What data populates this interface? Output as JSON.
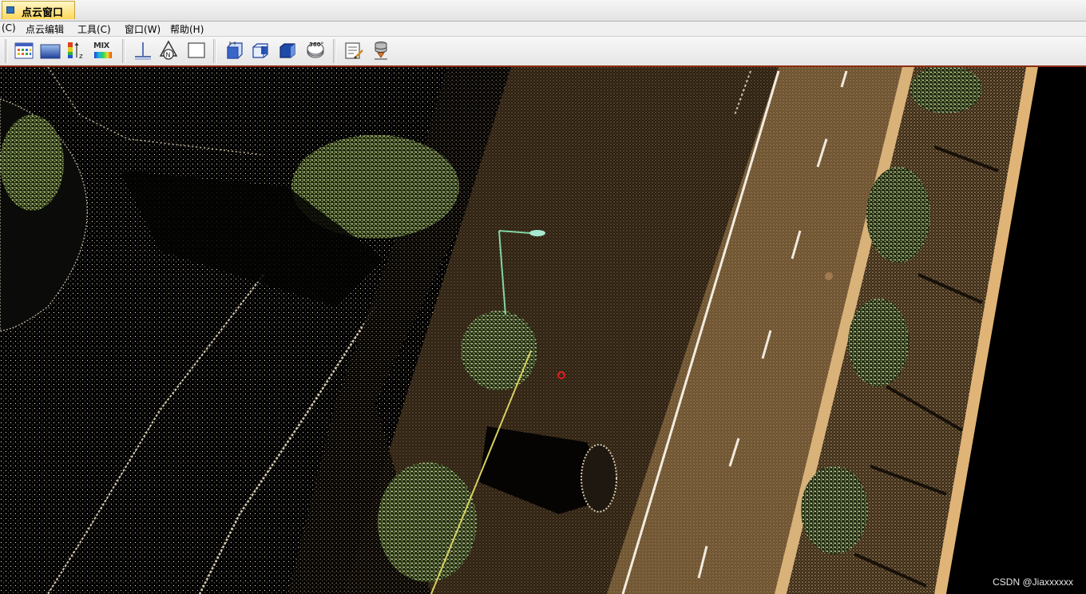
{
  "window": {
    "tab_label": "点云窗口"
  },
  "menu": {
    "items": [
      {
        "label": "(C)"
      },
      {
        "label": "点云编辑"
      },
      {
        "label": "工具(C)"
      },
      {
        "label": "窗口(W)"
      },
      {
        "label": "帮助(H)"
      }
    ]
  },
  "toolbar": {
    "mix_label": "MIX",
    "three_sixty_label": "360°",
    "z_label": "z",
    "north_label": "N",
    "icons": [
      "color-by-rgb-icon",
      "color-by-intensity-icon",
      "color-by-elevation-icon",
      "color-by-mix-icon",
      "ground-axis-icon",
      "north-view-icon",
      "blank-view-icon",
      "box-view-icon",
      "front-view-icon",
      "side-view-icon",
      "rotate-360-icon",
      "edit-notes-icon",
      "database-import-icon"
    ]
  },
  "viewport": {
    "description_icon": "point-cloud-view",
    "accent_colors": {
      "road": "#4a3a22",
      "vegetation": "#c8e080",
      "curb": "#e0b070",
      "lane_marking": "#ffffff",
      "pole": "#7ed0a0"
    }
  },
  "watermark": {
    "text": "CSDN @Jiaxxxxxx"
  }
}
